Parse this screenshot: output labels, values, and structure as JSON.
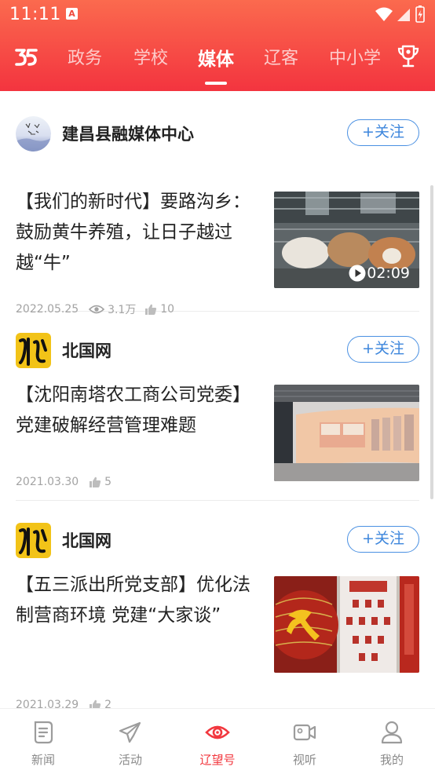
{
  "status_bar": {
    "time": "11:11",
    "notification_badge": "A"
  },
  "header": {
    "tabs": [
      {
        "label": "政务",
        "active": false
      },
      {
        "label": "学校",
        "active": false
      },
      {
        "label": "媒体",
        "active": true
      },
      {
        "label": "辽客",
        "active": false
      },
      {
        "label": "中小学",
        "active": false
      }
    ],
    "icons": {
      "logo": "app-logo-icon",
      "right": "trophy-icon"
    }
  },
  "feed": {
    "follow_label": "+关注",
    "articles": [
      {
        "source": "建昌县融媒体中心",
        "title": "【我们的新时代】要路沟乡：鼓励黄牛养殖，让日子越过越“牛”",
        "date": "2022.05.25",
        "views": "3.1万",
        "likes": "10",
        "video_duration": "02:09"
      },
      {
        "source": "北国网",
        "title": "【沈阳南塔农工商公司党委】党建破解经营管理难题",
        "date": "2021.03.30",
        "likes": "5"
      },
      {
        "source": "北国网",
        "title": "【五三派出所党支部】优化法制营商环境 党建“大家谈”",
        "date": "2021.03.29",
        "likes": "2"
      }
    ]
  },
  "bottom_nav": {
    "items": [
      {
        "label": "新闻",
        "icon": "news-icon",
        "active": false
      },
      {
        "label": "活动",
        "icon": "paper-plane-icon",
        "active": false
      },
      {
        "label": "辽望号",
        "icon": "eye-icon",
        "active": true
      },
      {
        "label": "视听",
        "icon": "video-camera-icon",
        "active": false
      },
      {
        "label": "我的",
        "icon": "user-icon",
        "active": false
      }
    ]
  },
  "colors": {
    "brand_red": "#f2373e",
    "follow_blue": "#3d86dc",
    "meta_gray": "#a3a3a3"
  }
}
